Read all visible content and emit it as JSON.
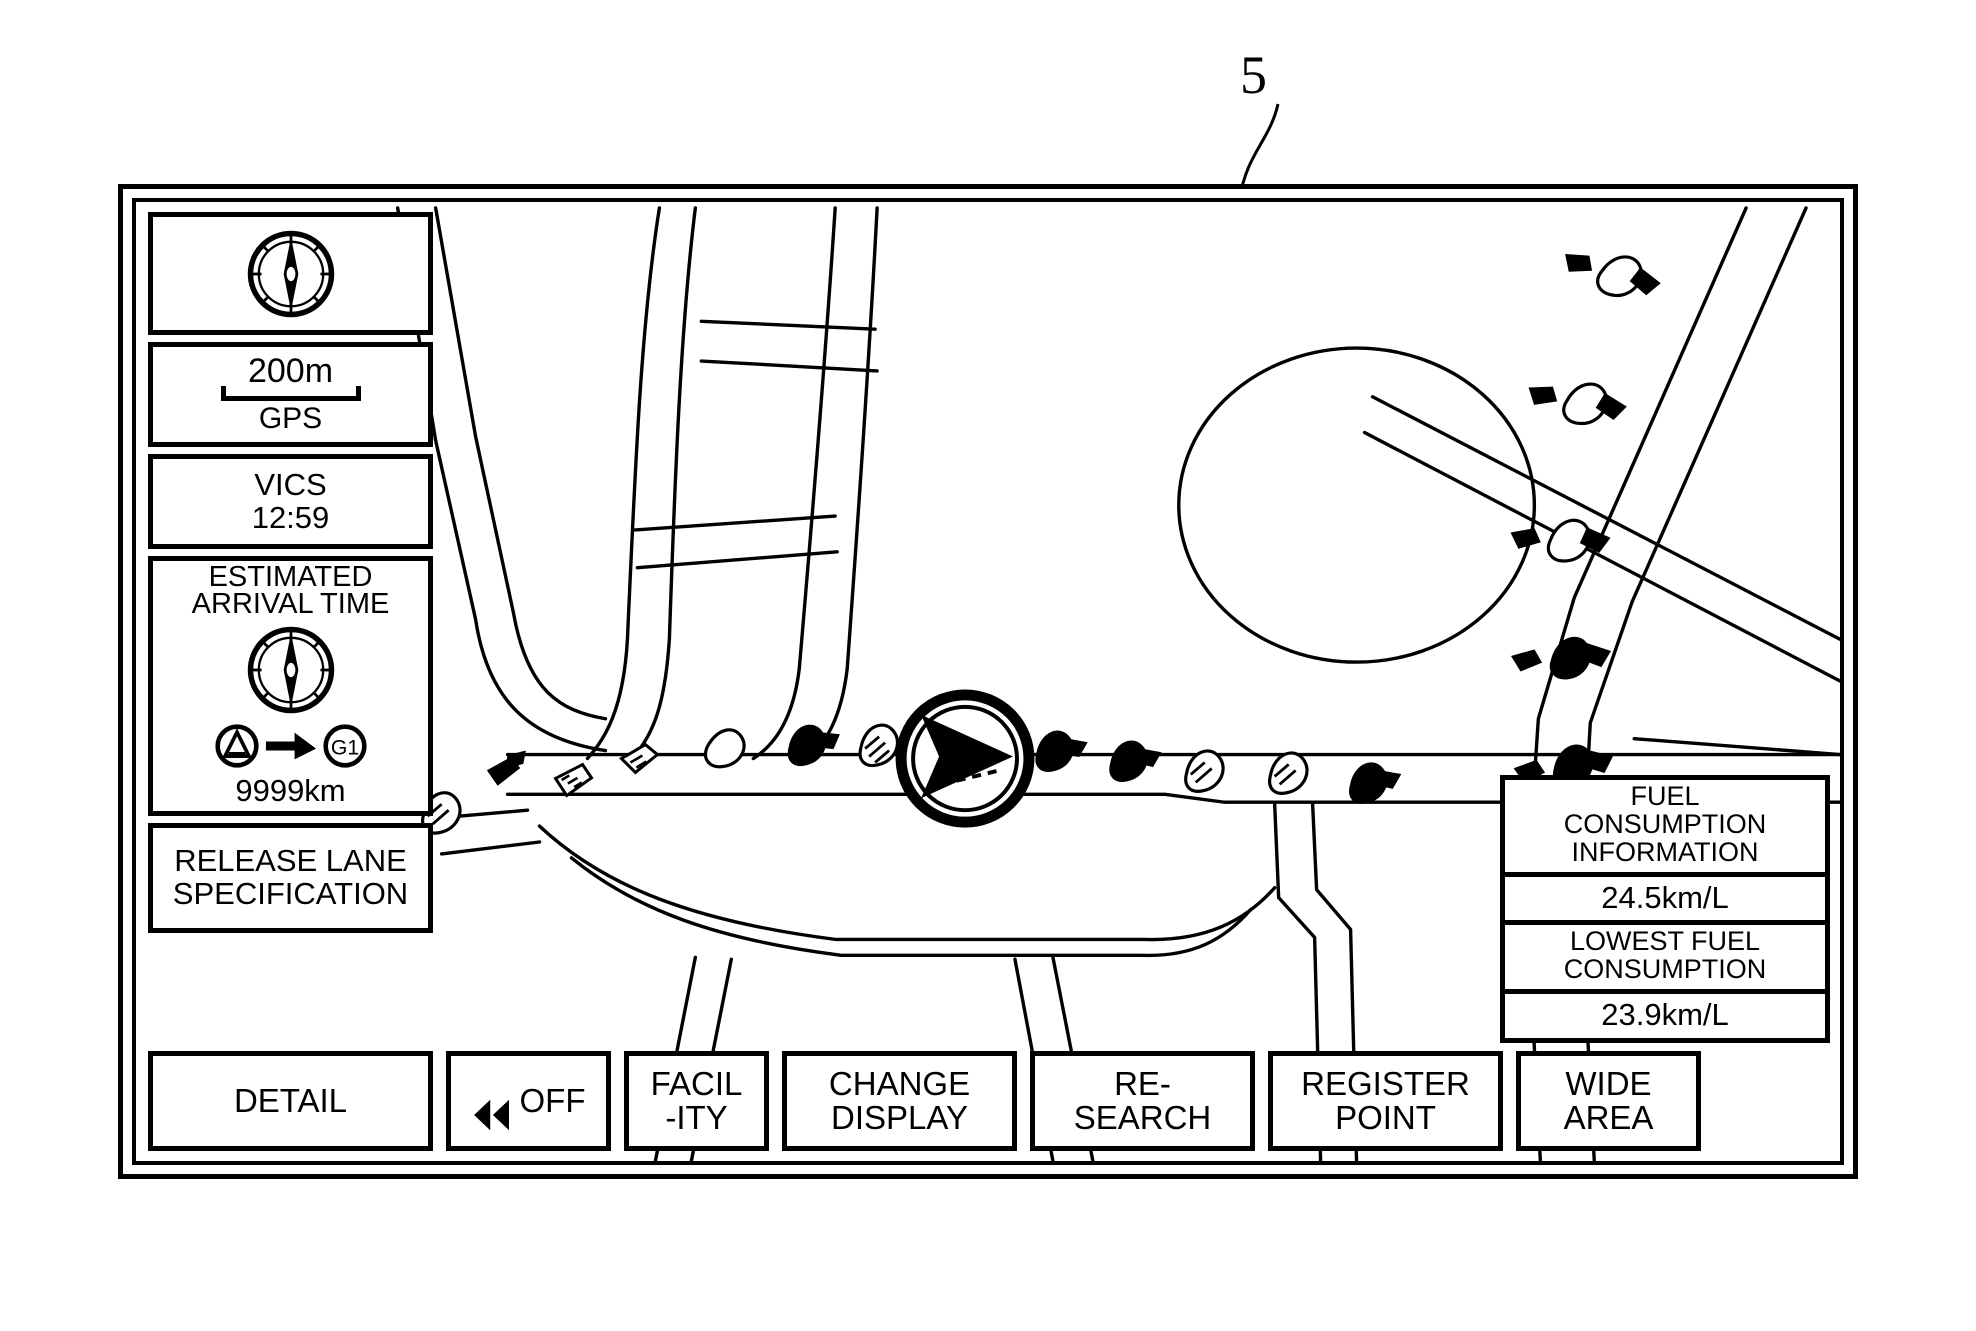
{
  "figure": {
    "reference_number": "5"
  },
  "sidebar": {
    "compass": {
      "icon": "compass-rose-icon"
    },
    "scale": {
      "distance": "200m",
      "source_label": "GPS"
    },
    "vics": {
      "label": "VICS",
      "time": "12:59"
    },
    "eta": {
      "title_line1": "ESTIMATED",
      "title_line2": "ARRIVAL TIME",
      "clock_icon": "compass-clock-icon",
      "origin_icon": "triangle-in-circle-icon",
      "route_arrow_icon": "right-arrow-icon",
      "destination_icon": "g1-circle-icon",
      "destination_label": "G1",
      "distance": "9999km"
    },
    "lane": {
      "line1": "RELEASE LANE",
      "line2": "SPECIFICATION"
    }
  },
  "fuel_info": {
    "title_line1": "FUEL",
    "title_line2": "CONSUMPTION",
    "title_line3": "INFORMATION",
    "current_value": "24.5km/L",
    "lowest_line1": "LOWEST FUEL",
    "lowest_line2": "CONSUMPTION",
    "lowest_value": "23.9km/L"
  },
  "buttons": [
    {
      "name": "detail",
      "label": "DETAIL"
    },
    {
      "name": "off",
      "label": "OFF",
      "icon": "rewind-double-left-icon"
    },
    {
      "name": "facility",
      "label": "FACIL\n-ITY"
    },
    {
      "name": "change-display",
      "label": "CHANGE\nDISPLAY"
    },
    {
      "name": "re-search",
      "label": "RE-\nSEARCH"
    },
    {
      "name": "register-point",
      "label": "REGISTER\nPOINT"
    },
    {
      "name": "wide-area",
      "label": "WIDE\nAREA"
    }
  ],
  "map": {
    "vehicle_marker": "vehicle-position-arrow-icon",
    "congestion_markers": "traffic-congestion-arrow-icons",
    "colors": {
      "ink": "#000000",
      "background": "#ffffff"
    }
  }
}
